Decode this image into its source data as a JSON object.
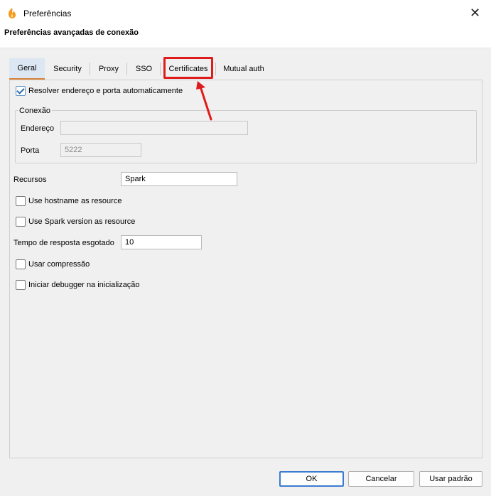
{
  "window": {
    "title": "Preferências",
    "close_label": "✕"
  },
  "header": {
    "title": "Preferências avançadas de conexão"
  },
  "tabs": [
    {
      "label": "Geral"
    },
    {
      "label": "Security"
    },
    {
      "label": "Proxy"
    },
    {
      "label": "SSO"
    },
    {
      "label": "Certificates"
    },
    {
      "label": "Mutual auth"
    }
  ],
  "general": {
    "auto_resolve": {
      "label": "Resolver endereço e porta automaticamente",
      "checked": true
    },
    "connection_group": {
      "legend": "Conexão",
      "address_label": "Endereço",
      "address_value": "",
      "port_label": "Porta",
      "port_value": "5222"
    },
    "resources_label": "Recursos",
    "resources_value": "Spark",
    "use_hostname": {
      "label": "Use hostname as resource",
      "checked": false
    },
    "use_spark_version": {
      "label": "Use Spark version as resource",
      "checked": false
    },
    "timeout_label": "Tempo de resposta esgotado",
    "timeout_value": "10",
    "compression": {
      "label": "Usar compressão",
      "checked": false
    },
    "debugger": {
      "label": "Iniciar debugger na inicialização",
      "checked": false
    }
  },
  "buttons": {
    "ok": "OK",
    "cancel": "Cancelar",
    "defaults": "Usar padrão"
  },
  "colors": {
    "highlight": "#e01b1b",
    "active_tab_underline": "#d9833a",
    "primary_border": "#3b7bd1"
  }
}
